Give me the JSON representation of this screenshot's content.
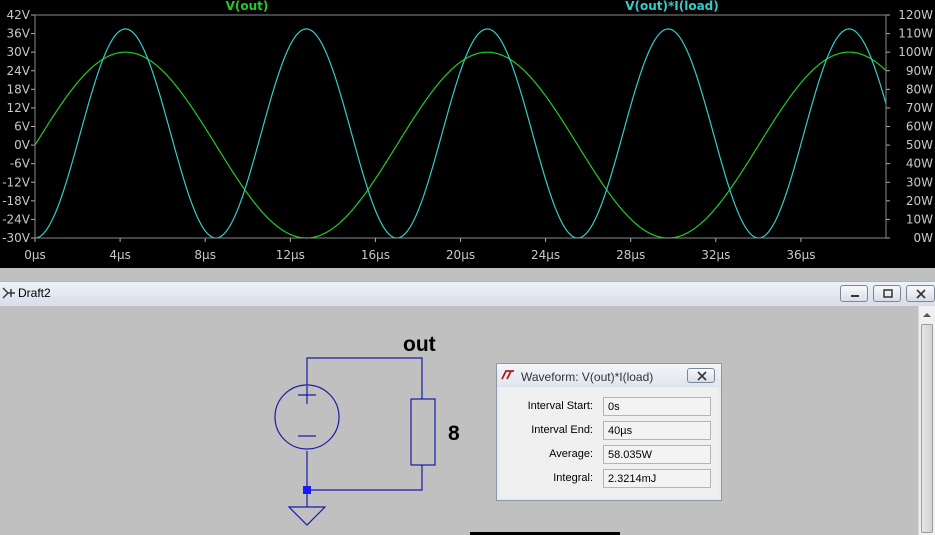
{
  "plot": {
    "trace_left_label": "V(out)",
    "trace_right_label": "V(out)*I(load)",
    "colors": {
      "v_out": "#22cc22",
      "power": "#33cccc",
      "background": "#000000",
      "tick_text": "#c8c8c8"
    },
    "left_ticks": [
      "42V",
      "36V",
      "30V",
      "24V",
      "18V",
      "12V",
      "6V",
      "0V",
      "-6V",
      "-12V",
      "-18V",
      "-24V",
      "-30V"
    ],
    "right_ticks": [
      "120W",
      "110W",
      "100W",
      "90W",
      "80W",
      "70W",
      "60W",
      "50W",
      "40W",
      "30W",
      "20W",
      "10W",
      "0W"
    ],
    "x_ticks": [
      "0µs",
      "4µs",
      "8µs",
      "12µs",
      "16µs",
      "20µs",
      "24µs",
      "28µs",
      "32µs",
      "36µs"
    ]
  },
  "chart_data": {
    "type": "line",
    "x_unit": "µs",
    "xlim": [
      0,
      40
    ],
    "series": [
      {
        "name": "V(out)",
        "axis": "left",
        "unit": "V",
        "function": "sine",
        "amplitude": 30,
        "frequency_mhz": 0.0588,
        "offset": 0,
        "ylim": [
          -30,
          42
        ]
      },
      {
        "name": "V(out)*I(load)",
        "axis": "right",
        "unit": "W",
        "function": "sine_squared",
        "peak": 112.5,
        "frequency_mhz": 0.0588,
        "ylim": [
          0,
          120
        ]
      }
    ]
  },
  "window": {
    "title": "Draft2"
  },
  "schematic": {
    "net_label": "out",
    "resistor_value": "8"
  },
  "dialog": {
    "title": "Waveform: V(out)*I(load)",
    "fields": [
      {
        "label": "Interval Start:",
        "value": "0s"
      },
      {
        "label": "Interval End:",
        "value": "40µs"
      },
      {
        "label": "Average:",
        "value": "58.035W"
      },
      {
        "label": "Integral:",
        "value": "2.3214mJ"
      }
    ]
  }
}
